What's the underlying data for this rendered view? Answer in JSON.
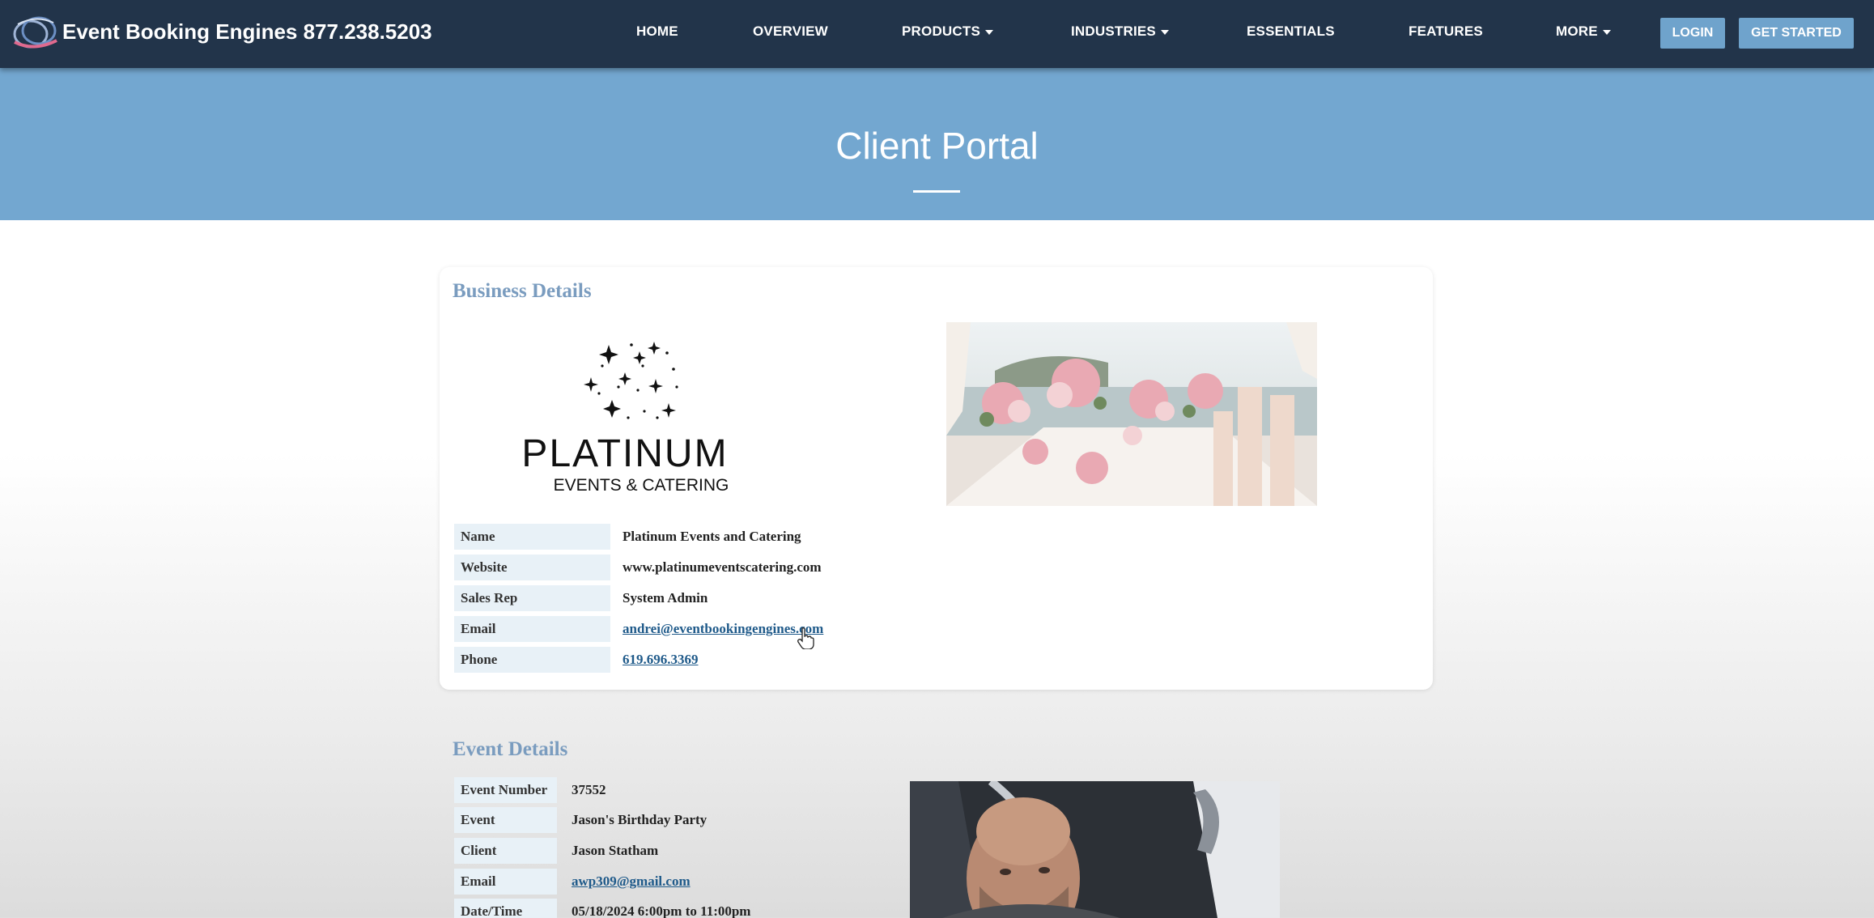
{
  "navbar": {
    "brand": "Event Booking Engines 877.238.5203",
    "links": [
      {
        "label": "HOME",
        "dropdown": false
      },
      {
        "label": "OVERVIEW",
        "dropdown": false
      },
      {
        "label": "PRODUCTS",
        "dropdown": true
      },
      {
        "label": "INDUSTRIES",
        "dropdown": true
      },
      {
        "label": "ESSENTIALS",
        "dropdown": false
      },
      {
        "label": "FEATURES",
        "dropdown": false
      },
      {
        "label": "MORE",
        "dropdown": true
      }
    ],
    "login_label": "LOGIN",
    "get_started_label": "GET STARTED"
  },
  "hero": {
    "title": "Client Portal"
  },
  "business": {
    "section_title": "Business Details",
    "logo_text": {
      "main": "PLATINUM",
      "sub": "EVENTS & CATERING"
    },
    "fields": [
      {
        "label": "Name",
        "value": "Platinum Events and Catering",
        "link": false
      },
      {
        "label": "Website",
        "value": "www.platinumeventscatering.com",
        "link": false
      },
      {
        "label": "Sales Rep",
        "value": "System Admin",
        "link": false
      },
      {
        "label": "Email",
        "value": "andrei@eventbookingengines.com",
        "link": true
      },
      {
        "label": "Phone",
        "value": "619.696.3369",
        "link": true
      }
    ]
  },
  "event": {
    "section_title": "Event Details",
    "fields": [
      {
        "label": "Event Number",
        "value": "37552",
        "link": false
      },
      {
        "label": "Event",
        "value": "Jason's Birthday Party",
        "link": false
      },
      {
        "label": "Client",
        "value": "Jason Statham",
        "link": false
      },
      {
        "label": "Email",
        "value": "awp309@gmail.com",
        "link": true
      },
      {
        "label": "Date/Time",
        "value": "05/18/2024 6:00pm to 11:00pm",
        "link": false
      }
    ]
  },
  "colors": {
    "navbar_bg": "#22344a",
    "hero_bg": "#73a7d0",
    "button_bg": "#6fa3cc",
    "section_title": "#7a9cbf",
    "label_bg": "#e8f1f7",
    "link": "#1f5a8a"
  },
  "icons": [
    "rings-logo-icon",
    "caret-down-icon",
    "pointer-cursor-icon"
  ]
}
